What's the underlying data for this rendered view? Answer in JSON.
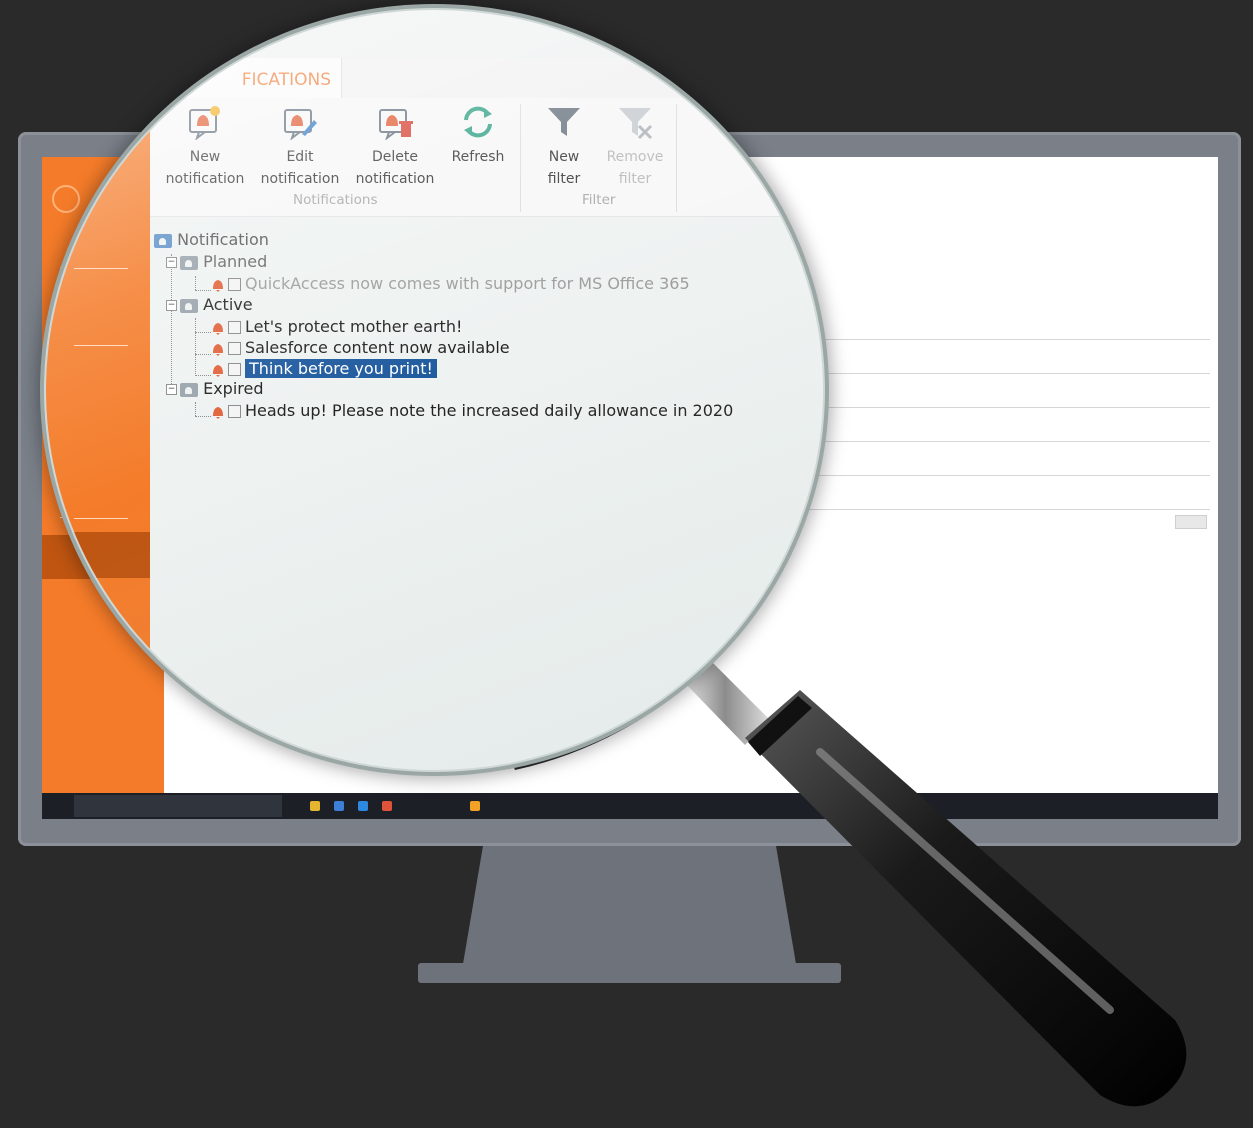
{
  "ribbon": {
    "tab_label": "FICATIONS",
    "buttons": [
      {
        "line1": "New",
        "line2": "notification",
        "icon": "bell-add-icon",
        "enabled": true
      },
      {
        "line1": "Edit",
        "line2": "notification",
        "icon": "bell-edit-icon",
        "enabled": true
      },
      {
        "line1": "Delete",
        "line2": "notification",
        "icon": "bell-delete-icon",
        "enabled": true
      },
      {
        "line1": "Refresh",
        "line2": "",
        "icon": "refresh-icon",
        "enabled": true
      },
      {
        "line1": "New",
        "line2": "filter",
        "icon": "filter-icon",
        "enabled": true
      },
      {
        "line1": "Remove",
        "line2": "filter",
        "icon": "filter-remove-icon",
        "enabled": false
      }
    ],
    "groups": {
      "notifications": "Notifications",
      "filter": "Filter"
    }
  },
  "tree": {
    "root": "Notification",
    "planned": {
      "label": "Planned",
      "items": [
        "QuickAccess now comes with support for MS Office 365"
      ]
    },
    "active": {
      "label": "Active",
      "items": [
        "Let's protect mother earth!",
        "Salesforce content now available",
        "Think before you print!"
      ]
    },
    "expired": {
      "label": "Expired",
      "items": [
        "Heads up! Please note the increased daily allowance in 2020"
      ]
    }
  },
  "colors": {
    "accent_orange": "#f47b29",
    "selection_blue": "#1e5a9e",
    "background": "#2a2a2a",
    "monitor_frame": "#7a7f88"
  }
}
